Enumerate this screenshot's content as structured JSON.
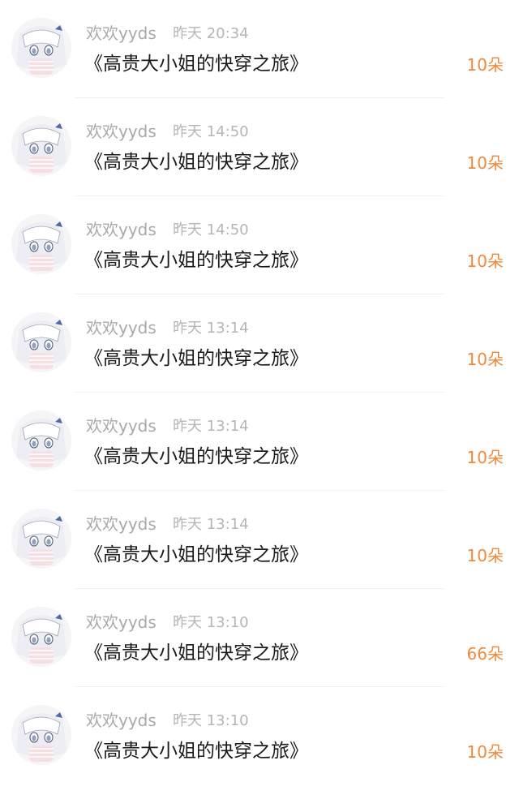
{
  "rows": [
    {
      "name": "欢欢yyds",
      "time": "昨天 20:34",
      "title": "《高贵大小姐的快穿之旅》",
      "amount": "10朵"
    },
    {
      "name": "欢欢yyds",
      "time": "昨天 14:50",
      "title": "《高贵大小姐的快穿之旅》",
      "amount": "10朵"
    },
    {
      "name": "欢欢yyds",
      "time": "昨天 14:50",
      "title": "《高贵大小姐的快穿之旅》",
      "amount": "10朵"
    },
    {
      "name": "欢欢yyds",
      "time": "昨天 13:14",
      "title": "《高贵大小姐的快穿之旅》",
      "amount": "10朵"
    },
    {
      "name": "欢欢yyds",
      "time": "昨天 13:14",
      "title": "《高贵大小姐的快穿之旅》",
      "amount": "10朵"
    },
    {
      "name": "欢欢yyds",
      "time": "昨天 13:14",
      "title": "《高贵大小姐的快穿之旅》",
      "amount": "10朵"
    },
    {
      "name": "欢欢yyds",
      "time": "昨天 13:10",
      "title": "《高贵大小姐的快穿之旅》",
      "amount": "66朵"
    },
    {
      "name": "欢欢yyds",
      "time": "昨天 13:10",
      "title": "《高贵大小姐的快穿之旅》",
      "amount": "10朵"
    }
  ],
  "colors": {
    "amount": "#f0893a",
    "name": "#a9a9a9",
    "time": "#b5b5b5",
    "title": "#1a1a1a"
  },
  "icons": {
    "avatar": "anime-girl-avatar-icon"
  }
}
